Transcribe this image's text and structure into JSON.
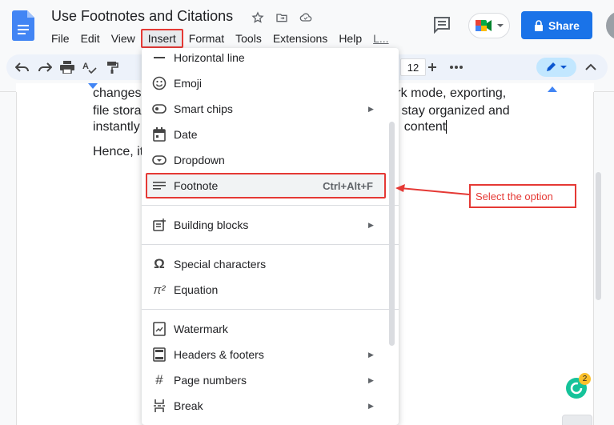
{
  "header": {
    "title": "Use Footnotes and Citations",
    "menus": [
      "File",
      "Edit",
      "View",
      "Insert",
      "Format",
      "Tools",
      "Extensions",
      "Help",
      "L..."
    ],
    "share_label": "Share"
  },
  "toolbar": {
    "font_size": "12"
  },
  "document": {
    "line1": "changes",
    "line1b": "e work mode, exporting,",
    "line2": "file stora",
    "line2b": "stay organized and",
    "line3": "instantly",
    "line3b": "content",
    "line4": "Hence, it"
  },
  "menu": {
    "items": [
      {
        "label": "Horizontal line",
        "icon": "horizontal-line-icon"
      },
      {
        "label": "Emoji",
        "icon": "emoji-icon"
      },
      {
        "label": "Smart chips",
        "icon": "smart-chips-icon",
        "submenu": true
      },
      {
        "label": "Date",
        "icon": "calendar-icon"
      },
      {
        "label": "Dropdown",
        "icon": "dropdown-icon"
      },
      {
        "label": "Footnote",
        "icon": "footnote-icon",
        "shortcut": "Ctrl+Alt+F"
      },
      {
        "label": "Building blocks",
        "icon": "building-blocks-icon",
        "submenu": true
      },
      {
        "label": "Special characters",
        "icon": "omega-icon"
      },
      {
        "label": "Equation",
        "icon": "pi-icon"
      },
      {
        "label": "Watermark",
        "icon": "watermark-icon"
      },
      {
        "label": "Headers & footers",
        "icon": "headers-footers-icon",
        "submenu": true
      },
      {
        "label": "Page numbers",
        "icon": "hash-icon",
        "submenu": true
      },
      {
        "label": "Break",
        "icon": "break-icon",
        "submenu": true
      }
    ]
  },
  "annotation": {
    "callout": "Select the option"
  },
  "grammarly": {
    "badge": "2"
  },
  "colors": {
    "accent": "#1a73e8",
    "highlight": "#e53935"
  }
}
